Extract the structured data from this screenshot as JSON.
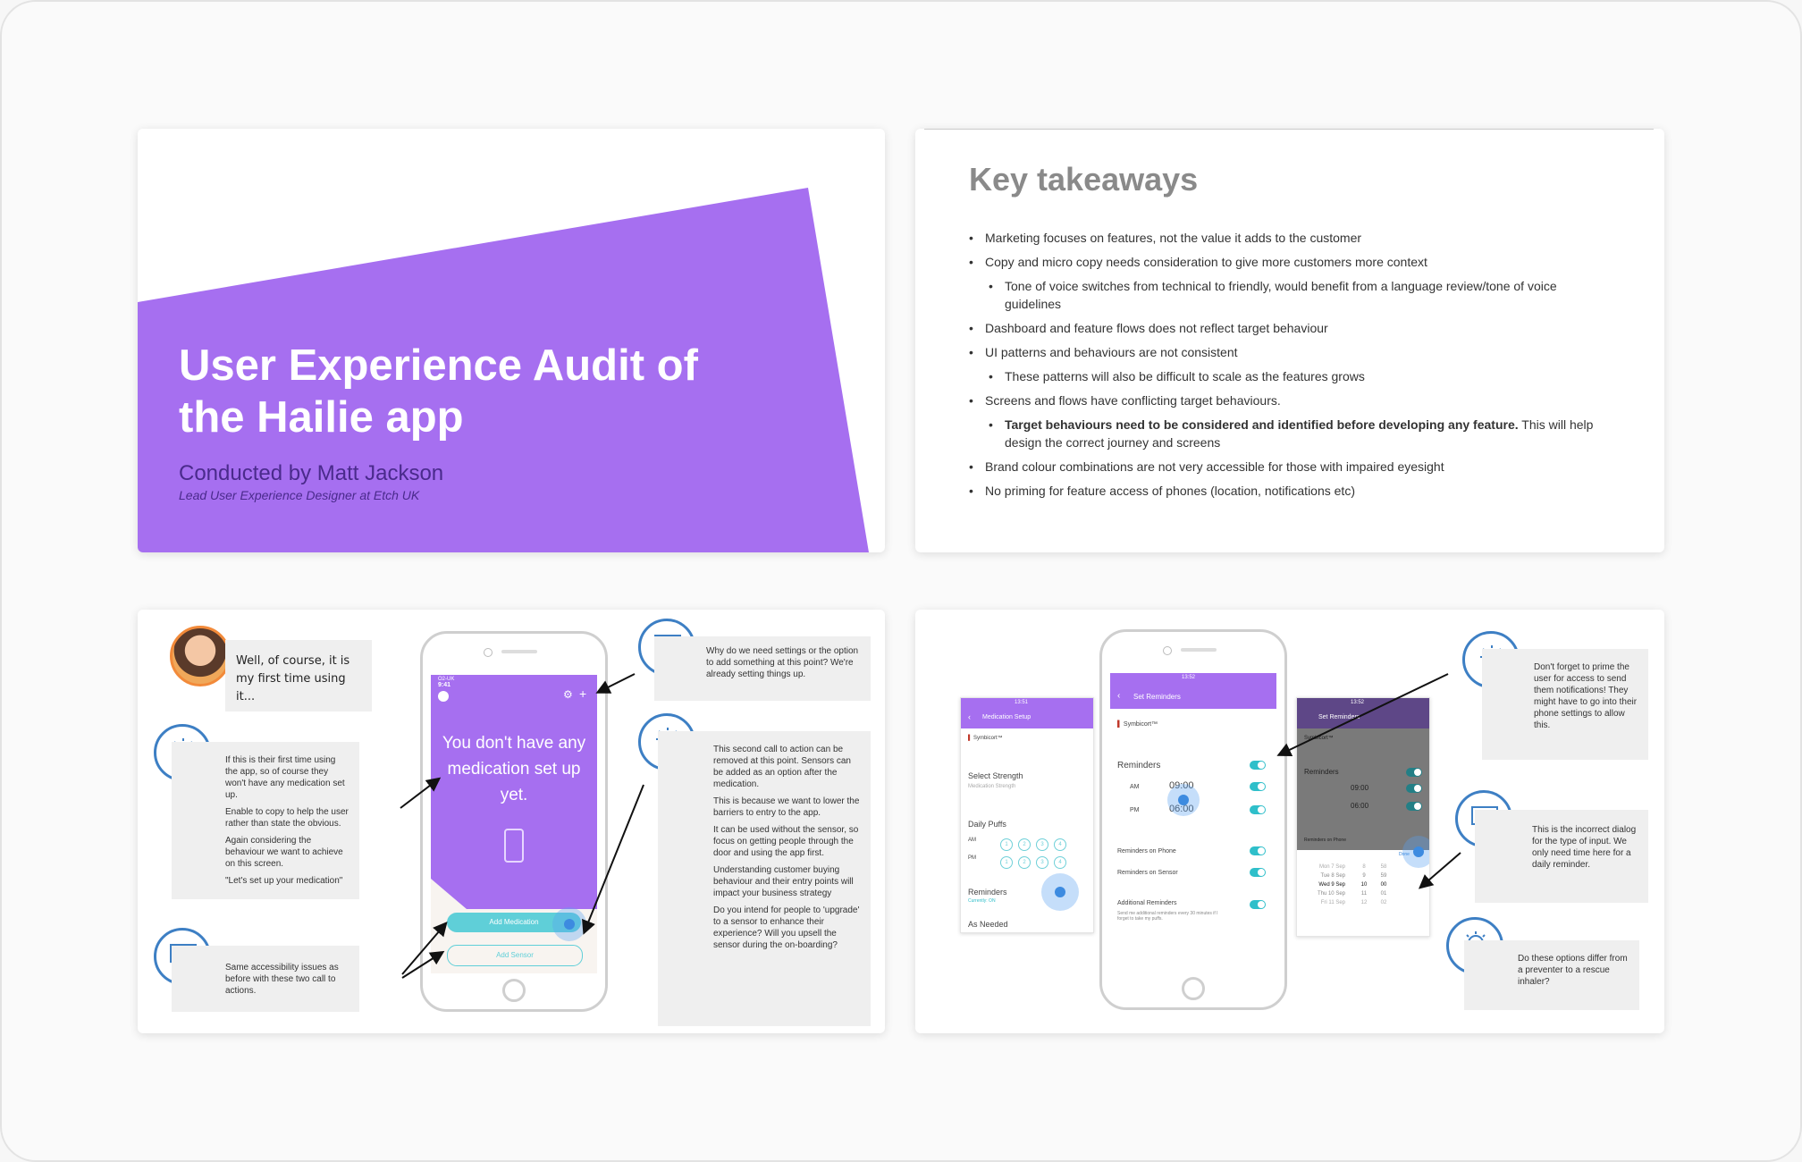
{
  "slide1": {
    "title": "User Experience Audit of the Hailie app",
    "conducted_by": "Conducted by Matt Jackson",
    "role": "Lead User Experience Designer at Etch UK"
  },
  "slide2": {
    "heading": "Key takeaways",
    "bullets": [
      "Marketing focuses on features, not the value it adds to the customer",
      "Copy and micro copy needs consideration to give more customers more context",
      "Tone of voice switches from technical to friendly, would benefit from a  language review/tone of voice guidelines",
      "Dashboard and feature flows does not reflect target behaviour",
      "UI patterns and behaviours are not consistent",
      "These patterns will also be difficult to scale as the features grows",
      "Screens and flows have conflicting target behaviours.",
      "Target behaviours need to be considered and identified before developing any feature.",
      " This will help design the correct journey and screens",
      "Brand colour combinations are not very accessible for those with impaired eyesight",
      "No priming for feature access of phones (location, notifications etc)"
    ]
  },
  "slide3": {
    "persona_quote": "Well, of course, it is my first time using it...",
    "note_first_time": [
      "If this is their first time using the app, so of course they won't have any medication set up.",
      "Enable to copy to help the user rather than state the obvious.",
      "Again considering the behaviour we want to achieve on this screen.",
      "\"Let's set up your medication\""
    ],
    "note_accessibility": "Same accessibility issues as before with these two call to actions.",
    "note_settings": "Why do we need settings or the option to add something at this point? We're already setting things up.",
    "note_second_cta": [
      "This second call to action can be removed at this point. Sensors can be added as an option after the medication.",
      "This is because we want to lower the barriers to entry to the app.",
      "It can be used without the sensor, so focus on getting people through the door and using the app first.",
      "Understanding customer buying behaviour and their entry points will impact your business strategy",
      "Do you intend for people to 'upgrade' to a sensor to enhance their experience? Will you upsell the sensor during the on-boarding?"
    ],
    "phone": {
      "status_left": "O2-UK",
      "time": "9:41",
      "empty_message": "You don't have any medication set up yet.",
      "add_medication": "Add Medication",
      "add_sensor": "Add Sensor"
    }
  },
  "slide4": {
    "left_screen": {
      "time": "13:51",
      "title": "Medication Setup",
      "medicine": "Symbicort™",
      "select_strength": "Select Strength",
      "strength_placeholder": "Medication Strength",
      "daily_puffs": "Daily Puffs",
      "am": "AM",
      "pm": "PM",
      "puffs": [
        "1",
        "2",
        "3",
        "4"
      ],
      "reminders": "Reminders",
      "reminders_sub": "Currently: ON",
      "as_needed": "As Needed"
    },
    "center_screen": {
      "time": "13:52",
      "title": "Set Reminders",
      "medicine": "Symbicort™",
      "reminders": "Reminders",
      "am": "AM",
      "am_time": "09:00",
      "pm": "PM",
      "pm_time": "06:00",
      "on_phone": "Reminders on Phone",
      "on_sensor": "Reminders on Sensor",
      "additional": "Additional Reminders",
      "additional_sub": "Send me additional reminders every 30 minutes if I forget to take my puffs."
    },
    "right_screen": {
      "time": "13:52",
      "title": "Set Reminders",
      "medicine": "Symbicort™",
      "reminders": "Reminders",
      "am_time": "09:00",
      "pm_time": "06:00",
      "on_phone": "Reminders on Phone",
      "done": "Done",
      "picker_days": [
        "Mon 7 Sep",
        "Tue 8 Sep",
        "Wed 9 Sep",
        "Thu 10 Sep",
        "Fri 11 Sep"
      ],
      "picker_hours": [
        "8",
        "9",
        "10",
        "11",
        "12"
      ],
      "picker_mins": [
        "58",
        "59",
        "00",
        "01",
        "02"
      ]
    },
    "note_prime": "Don't forget to prime the user for access to send them notifications! They might have to go into their phone settings to allow this.",
    "note_dialog": "This is the incorrect dialog for the type of input. We only need time here for a daily reminder.",
    "note_options": "Do these options differ from a preventer to a rescue inhaler?"
  },
  "colors": {
    "brand_purple": "#a66ff0",
    "accent_teal": "#2fbfca",
    "icon_blue": "#3d7fc4"
  }
}
